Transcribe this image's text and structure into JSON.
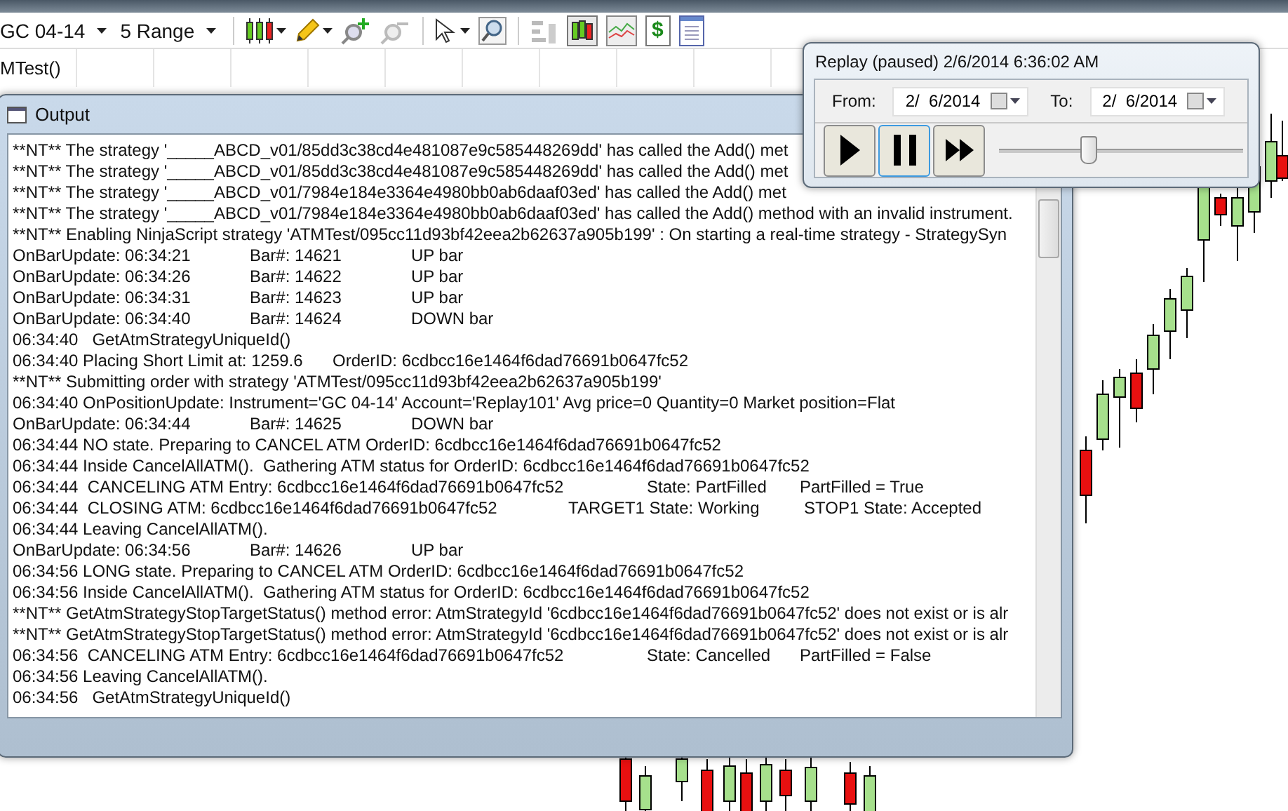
{
  "toolbar": {
    "instrument": "GC 04-14",
    "period": "5 Range",
    "dollar_glyph": "$"
  },
  "chart": {
    "indicator_label": "MTest()"
  },
  "output_window": {
    "title": "Output",
    "lines": [
      {
        "kind": "plain",
        "parts": [
          "**NT** The strategy '_____ABCD_v01/85dd3c38cd4e481087e9c585448269dd' has called the Add() met"
        ]
      },
      {
        "kind": "plain",
        "parts": [
          "**NT** The strategy '_____ABCD_v01/85dd3c38cd4e481087e9c585448269dd' has called the Add() met"
        ]
      },
      {
        "kind": "plain",
        "parts": [
          "**NT** The strategy '_____ABCD_v01/7984e184e3364e4980bb0ab6daaf03ed' has called the Add() met"
        ]
      },
      {
        "kind": "plain",
        "parts": [
          "**NT** The strategy '_____ABCD_v01/7984e184e3364e4980bb0ab6daaf03ed' has called the Add() method with an invalid instrument."
        ]
      },
      {
        "kind": "plain",
        "parts": [
          "**NT** Enabling NinjaScript strategy 'ATMTest/095cc11d93bf42eea2b62637a905b199' : On starting a real-time strategy - StrategySyn"
        ]
      },
      {
        "kind": "bar",
        "parts": [
          "OnBarUpdate: 06:34:21",
          "Bar#: 14621",
          "UP bar"
        ]
      },
      {
        "kind": "bar",
        "parts": [
          "OnBarUpdate: 06:34:26",
          "Bar#: 14622",
          "UP bar"
        ]
      },
      {
        "kind": "bar",
        "parts": [
          "OnBarUpdate: 06:34:31",
          "Bar#: 14623",
          "UP bar"
        ]
      },
      {
        "kind": "bar",
        "parts": [
          "OnBarUpdate: 06:34:40",
          "Bar#: 14624",
          "DOWN bar"
        ]
      },
      {
        "kind": "plain",
        "parts": [
          "06:34:40   GetAtmStrategyUniqueId()"
        ]
      },
      {
        "kind": "order",
        "parts": [
          "06:34:40 Placing Short Limit at: 1259.6",
          "OrderID: 6cdbcc16e1464f6dad76691b0647fc52"
        ]
      },
      {
        "kind": "plain",
        "parts": [
          "**NT** Submitting order with strategy 'ATMTest/095cc11d93bf42eea2b62637a905b199'"
        ]
      },
      {
        "kind": "plain",
        "parts": [
          "06:34:40 OnPositionUpdate: Instrument='GC 04-14' Account='Replay101' Avg price=0 Quantity=0 Market position=Flat"
        ]
      },
      {
        "kind": "bar",
        "parts": [
          "OnBarUpdate: 06:34:44",
          "Bar#: 14625",
          "DOWN bar"
        ]
      },
      {
        "kind": "plain",
        "parts": [
          "06:34:44 NO state. Preparing to CANCEL ATM OrderID: 6cdbcc16e1464f6dad76691b0647fc52"
        ]
      },
      {
        "kind": "plain",
        "parts": [
          "06:34:44 Inside CancelAllATM().  Gathering ATM status for OrderID: 6cdbcc16e1464f6dad76691b0647fc52"
        ]
      },
      {
        "kind": "atm",
        "parts": [
          "06:34:44  CANCELING ATM Entry: 6cdbcc16e1464f6dad76691b0647fc52",
          "State: PartFilled",
          "PartFilled = True"
        ]
      },
      {
        "kind": "closing",
        "parts": [
          "06:34:44  CLOSING ATM: 6cdbcc16e1464f6dad76691b0647fc52",
          "TARGET1 State: Working",
          "STOP1 State: Accepted"
        ]
      },
      {
        "kind": "plain",
        "parts": [
          "06:34:44 Leaving CancelAllATM()."
        ]
      },
      {
        "kind": "bar",
        "parts": [
          "OnBarUpdate: 06:34:56",
          "Bar#: 14626",
          "UP bar"
        ]
      },
      {
        "kind": "plain",
        "parts": [
          "06:34:56 LONG state. Preparing to CANCEL ATM OrderID: 6cdbcc16e1464f6dad76691b0647fc52"
        ]
      },
      {
        "kind": "plain",
        "parts": [
          "06:34:56 Inside CancelAllATM().  Gathering ATM status for OrderID: 6cdbcc16e1464f6dad76691b0647fc52"
        ]
      },
      {
        "kind": "plain",
        "parts": [
          "**NT** GetAtmStrategyStopTargetStatus() method error: AtmStrategyId '6cdbcc16e1464f6dad76691b0647fc52' does not exist or is alr"
        ]
      },
      {
        "kind": "plain",
        "parts": [
          "**NT** GetAtmStrategyStopTargetStatus() method error: AtmStrategyId '6cdbcc16e1464f6dad76691b0647fc52' does not exist or is alr"
        ]
      },
      {
        "kind": "atm",
        "parts": [
          "06:34:56  CANCELING ATM Entry: 6cdbcc16e1464f6dad76691b0647fc52",
          "State: Cancelled",
          "PartFilled = False"
        ]
      },
      {
        "kind": "plain",
        "parts": [
          "06:34:56 Leaving CancelAllATM()."
        ]
      },
      {
        "kind": "plain",
        "parts": [
          "06:34:56   GetAtmStrategyUniqueId()"
        ]
      }
    ]
  },
  "replay_window": {
    "title": "Replay (paused) 2/6/2014 6:36:02 AM",
    "from_label": "From:",
    "from_date": "2/  6/2014",
    "to_label": "To:",
    "to_date": "2/  6/2014",
    "buttons": [
      {
        "kind": "play",
        "selected": false
      },
      {
        "kind": "pause",
        "selected": true
      },
      {
        "kind": "fast_forward",
        "selected": false
      }
    ],
    "speed": {
      "level": 0.36
    }
  }
}
